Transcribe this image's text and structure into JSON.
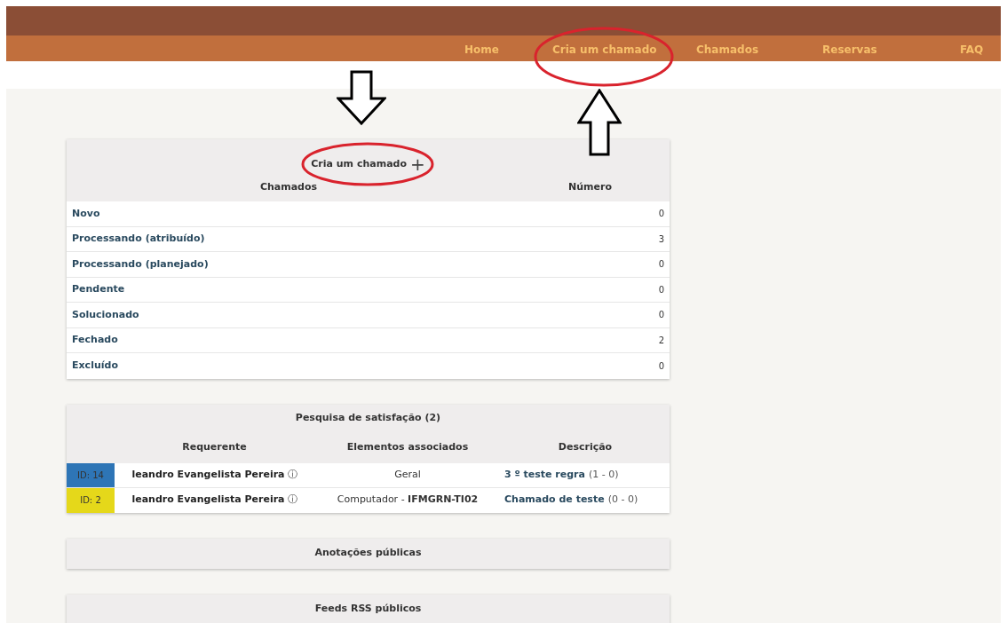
{
  "nav": [
    {
      "label": "Home"
    },
    {
      "label": "Cria um chamado"
    },
    {
      "label": "Chamados"
    },
    {
      "label": "Reservas"
    },
    {
      "label": "FAQ"
    }
  ],
  "tickets_panel": {
    "create_link": "Cria um chamado",
    "create_icon": "+",
    "columns": [
      "Chamados",
      "Número"
    ],
    "rows": [
      {
        "status": "Novo",
        "count": "0"
      },
      {
        "status": "Processando (atribuído)",
        "count": "3"
      },
      {
        "status": "Processando (planejado)",
        "count": "0"
      },
      {
        "status": "Pendente",
        "count": "0"
      },
      {
        "status": "Solucionado",
        "count": "0"
      },
      {
        "status": "Fechado",
        "count": "2"
      },
      {
        "status": "Excluído",
        "count": "0"
      }
    ]
  },
  "survey_panel": {
    "title": "Pesquisa de satisfação (2)",
    "columns": [
      "Requerente",
      "Elementos associados",
      "Descrição"
    ],
    "rows": [
      {
        "id": "ID: 14",
        "color": "#2e75b6",
        "requester": "leandro Evangelista Pereira",
        "info_icon": "ⓘ",
        "elements": "Geral",
        "description": "3 º teste regra",
        "counts": "(1 - 0)"
      },
      {
        "id": "ID: 2",
        "color": "#e5d81a",
        "requester": "leandro Evangelista Pereira",
        "info_icon": "ⓘ",
        "elements": "Computador - **IFMGRN-TI02**",
        "description": "Chamado de teste",
        "counts": "(0 - 0)"
      }
    ]
  },
  "panels": [
    {
      "title": "Anotações públicas"
    },
    {
      "title": "Feeds RSS públicos"
    }
  ]
}
